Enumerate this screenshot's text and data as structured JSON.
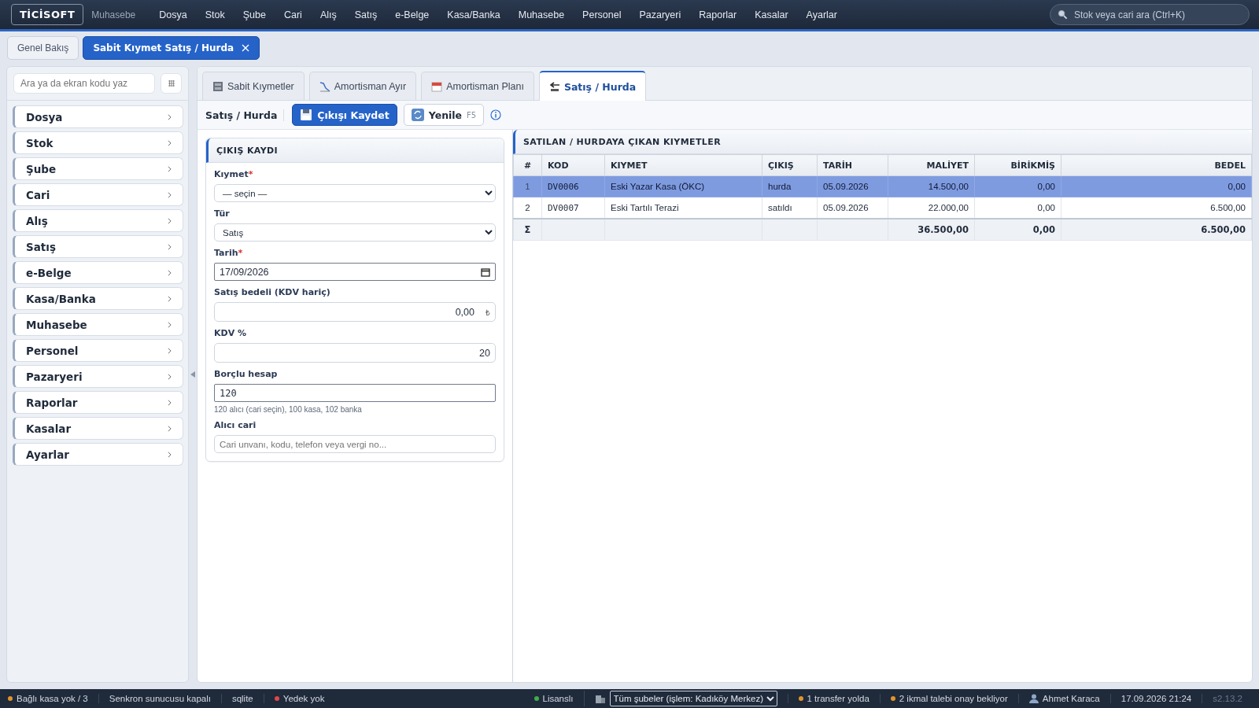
{
  "topbar": {
    "brand": "TİCİSOFT",
    "module": "Muhasebe",
    "menu": [
      "Dosya",
      "Stok",
      "Şube",
      "Cari",
      "Alış",
      "Satış",
      "e-Belge",
      "Kasa/Banka",
      "Muhasebe",
      "Personel",
      "Pazaryeri",
      "Raporlar",
      "Kasalar",
      "Ayarlar"
    ],
    "search": {
      "placeholder": "Stok veya cari ara (Ctrl+K)"
    }
  },
  "doc_tabs": [
    {
      "label": "Genel Bakış",
      "selected": false,
      "closable": false
    },
    {
      "label": "Sabit Kıymet Satış / Hurda",
      "selected": true,
      "closable": true
    }
  ],
  "sidebar": {
    "search": {
      "placeholder": "Ara ya da ekran kodu yaz"
    },
    "items": [
      "Dosya",
      "Stok",
      "Şube",
      "Cari",
      "Alış",
      "Satış",
      "e-Belge",
      "Kasa/Banka",
      "Muhasebe",
      "Personel",
      "Pazaryeri",
      "Raporlar",
      "Kasalar",
      "Ayarlar"
    ]
  },
  "tabs": [
    {
      "label": "Sabit Kıymetler",
      "selected": false
    },
    {
      "label": "Amortisman Ayır",
      "selected": false
    },
    {
      "label": "Amortisman Planı",
      "selected": false
    },
    {
      "label": "Satış / Hurda",
      "selected": true
    }
  ],
  "toolbar": {
    "title": "Satış / Hurda",
    "buttons": [
      {
        "label": "Çıkışı Kaydet",
        "kind": "primary"
      },
      {
        "label": "Yenile",
        "kind": "secondary",
        "shortcut": "F5"
      }
    ]
  },
  "form": {
    "title": "ÇIKIŞ KAYDI",
    "required_mark": "*",
    "fields": [
      {
        "kind": "select",
        "label": "Kıymet",
        "required": true,
        "value": "— seçin —"
      },
      {
        "kind": "select",
        "label": "Tür",
        "required": false,
        "value": "Satış"
      },
      {
        "kind": "date",
        "label": "Tarih",
        "required": true,
        "value": "17/09/2026"
      },
      {
        "kind": "money",
        "label": "Satış bedeli (KDV hariç)",
        "required": false,
        "value": "0,00",
        "suffix": "₺"
      },
      {
        "kind": "number",
        "label": "KDV %",
        "required": false,
        "value": "20"
      },
      {
        "kind": "code",
        "label": "Borçlu hesap",
        "required": false,
        "value": "120",
        "hint": "120 alıcı (cari seçin), 100 kasa, 102 banka"
      },
      {
        "kind": "search",
        "label": "Alıcı cari",
        "required": false,
        "placeholder": "Cari unvanı, kodu, telefon veya vergi no..."
      }
    ]
  },
  "table": {
    "title": "SATILAN / HURDAYA ÇIKAN KIYMETLER",
    "columns": [
      "#",
      "KOD",
      "KIYMET",
      "ÇIKIŞ",
      "TARİH",
      "MALİYET",
      "BİRİKMİŞ",
      "BEDEL"
    ],
    "rows": [
      {
        "selected": true,
        "cells": [
          "1",
          "DV0006",
          "Eski Yazar Kasa (ÖKC)",
          "hurda",
          "05.09.2026",
          "14.500,00",
          "0,00",
          "0,00"
        ]
      },
      {
        "selected": false,
        "cells": [
          "2",
          "DV0007",
          "Eski Tartılı Terazi",
          "satıldı",
          "05.09.2026",
          "22.000,00",
          "0,00",
          "6.500,00"
        ]
      }
    ],
    "totals": {
      "symbol": "Σ",
      "cost": "36.500,00",
      "accumulated": "0,00",
      "amount": "6.500,00"
    }
  },
  "status_bar": {
    "left": [
      {
        "text": "Bağlı kasa yok / 3",
        "color": "#e0952a"
      },
      {
        "text": "Senkron sunucusu kapalı"
      },
      {
        "text": "sqlite"
      },
      {
        "text": "Yedek yok",
        "color": "#e04848"
      }
    ],
    "right": [
      {
        "kind": "text",
        "text": "Lisanslı",
        "color": "#3fae49"
      },
      {
        "kind": "branch",
        "text": "Tüm şubeler (işlem: Kadıköy Merkez)"
      },
      {
        "kind": "text",
        "text": "1 transfer yolda",
        "color": "#e0952a"
      },
      {
        "kind": "text",
        "text": "2 ikmal talebi onay bekliyor",
        "color": "#e0952a"
      },
      {
        "kind": "user",
        "text": "Ahmet Karaca"
      },
      {
        "kind": "text",
        "text": "17.09.2026 21:24"
      },
      {
        "kind": "version",
        "text": "s2.13.2"
      }
    ]
  }
}
